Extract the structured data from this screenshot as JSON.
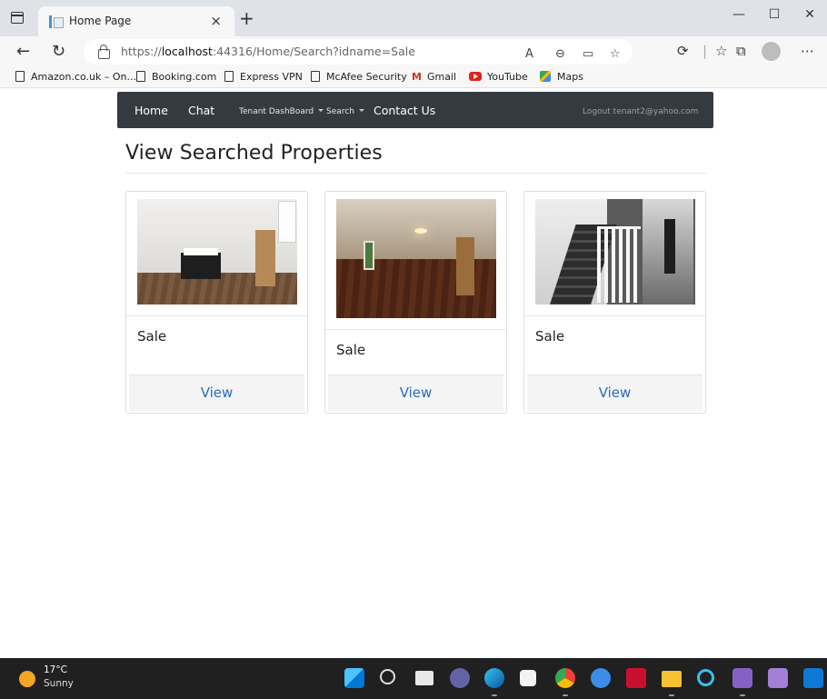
{
  "browser": {
    "tab_title": "Home Page",
    "tab_close": "×",
    "new_tab": "+",
    "window_controls": [
      "—",
      "☐",
      "✕"
    ],
    "url_prefix": "https://",
    "url_host": "localhost",
    "url_rest": ":44316/Home/Search?idname=Sale",
    "toolbar_icons": [
      "read-aloud-icon",
      "zoom-icon",
      "immersive-reader-icon",
      "add-favorite-icon",
      "extensions-icon",
      "favorites-icon",
      "collections-icon",
      "profile-icon",
      "more-icon"
    ],
    "favorites": [
      {
        "label": "Amazon.co.uk – On...",
        "icon": "page-icon"
      },
      {
        "label": "Booking.com",
        "icon": "page-icon"
      },
      {
        "label": "Express VPN",
        "icon": "page-icon"
      },
      {
        "label": "McAfee Security",
        "icon": "page-icon"
      },
      {
        "label": "Gmail",
        "icon": "gmail-icon"
      },
      {
        "label": "YouTube",
        "icon": "youtube-icon"
      },
      {
        "label": "Maps",
        "icon": "maps-icon"
      }
    ]
  },
  "navbar": {
    "home": "Home",
    "chat": "Chat",
    "tenant_dashboard": "Tenant DashBoard",
    "search": "Search",
    "contact": "Contact Us",
    "logout": "Logout tenant2@yahoo.com"
  },
  "page": {
    "heading": "View Searched Properties",
    "cards": [
      {
        "label": "Sale",
        "button": "View"
      },
      {
        "label": "Sale",
        "button": "View"
      },
      {
        "label": "Sale",
        "button": "View"
      }
    ]
  },
  "taskbar": {
    "temperature": "17°C",
    "condition": "Sunny",
    "apps": [
      "start-icon",
      "search-icon",
      "task-view-icon",
      "teams-chat-icon",
      "edge-icon",
      "store-icon",
      "chrome-icon",
      "app-icon",
      "mcafee-icon",
      "file-explorer-icon",
      "cortana-icon",
      "visual-studio-icon",
      "visual-studio-preview-icon",
      "outlook-icon"
    ]
  }
}
